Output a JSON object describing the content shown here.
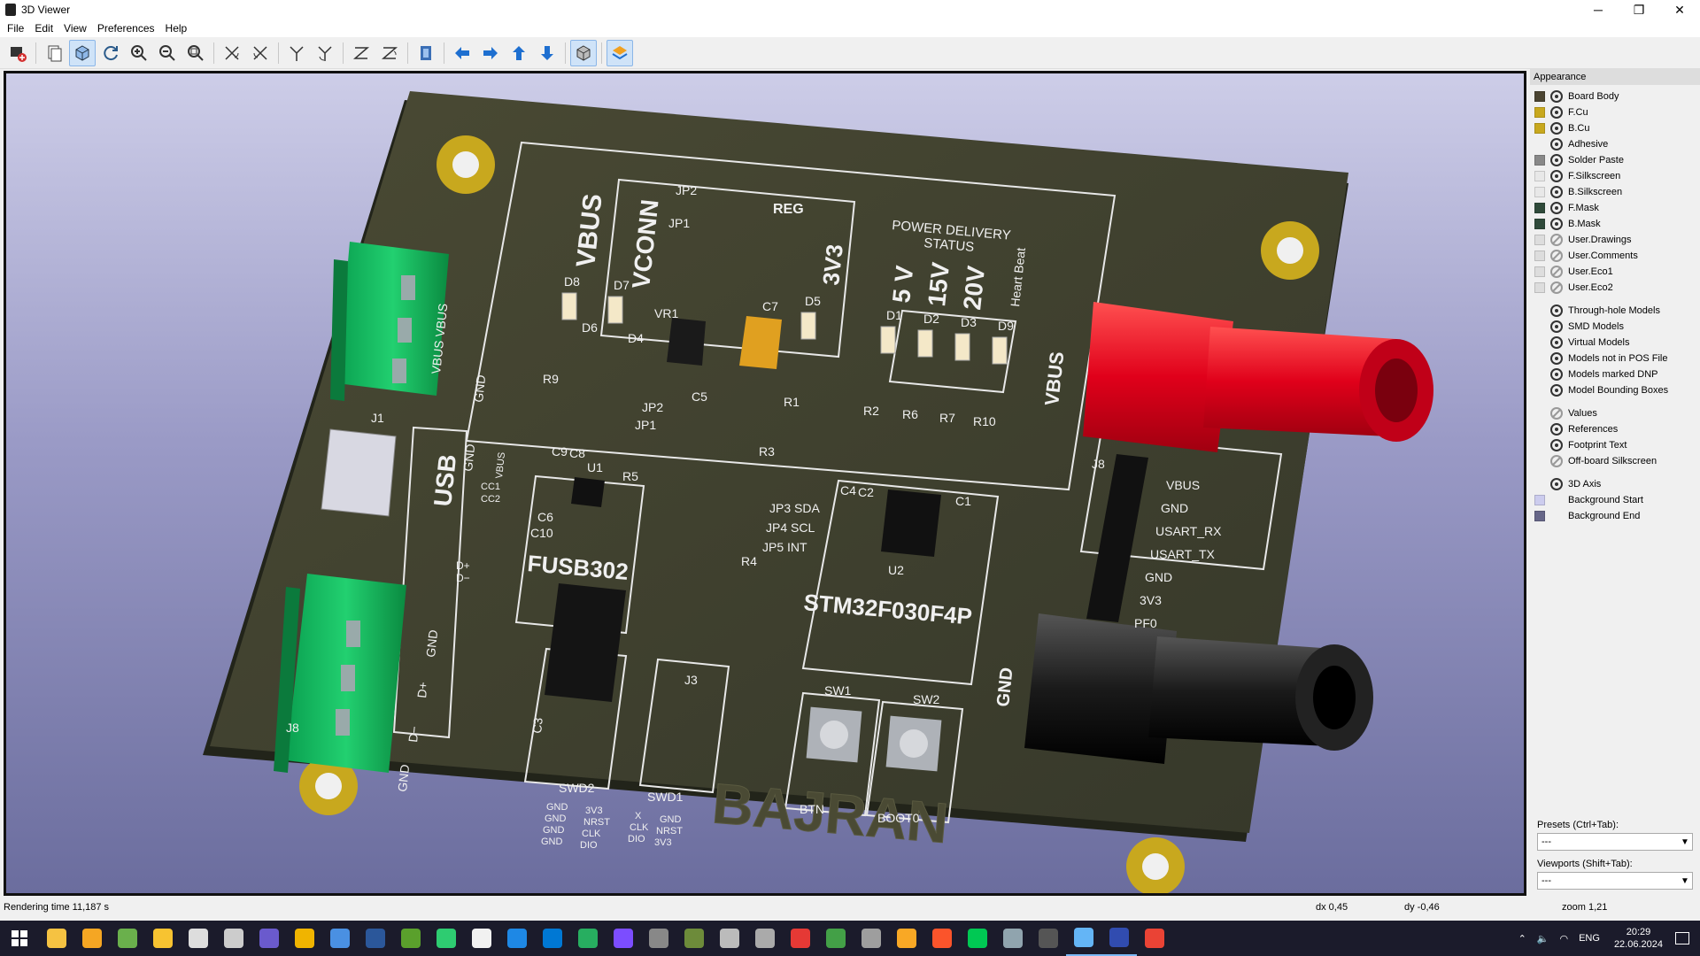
{
  "window": {
    "title": "3D Viewer",
    "controls": [
      "─",
      "❐",
      "✕"
    ]
  },
  "menu": [
    "File",
    "Edit",
    "View",
    "Preferences",
    "Help"
  ],
  "toolbar": {
    "tools": [
      "render-export-icon",
      "copy-icon",
      "raytrace-icon",
      "refresh-icon",
      "zoom-in-icon",
      "zoom-out-icon",
      "zoom-fit-icon",
      "rotate-x-cw-icon",
      "rotate-x-ccw-icon",
      "rotate-y-cw-icon",
      "rotate-y-ccw-icon",
      "rotate-z-cw-icon",
      "rotate-z-ccw-icon",
      "flip-board-icon",
      "pan-left-icon",
      "pan-right-icon",
      "pan-up-icon",
      "pan-down-icon",
      "ortho-icon",
      "layers-icon"
    ]
  },
  "board": {
    "labels": {
      "vbus": "VBUS",
      "vconn": "VCONN",
      "reg": "REG",
      "v3v3": "3V3",
      "pd_status": "POWER DELIVERY",
      "pd_status2": "STATUS",
      "v5": "5 V",
      "v15": "15V",
      "v20": "20V",
      "heartbeat": "Heart Beat",
      "usb": "USB",
      "fusb": "FUSB302",
      "stm": "STM32F030F4P",
      "brand": "BAJRAN",
      "jp2": "JP2",
      "jp1": "JP1",
      "jp2b": "JP2",
      "jp1b": "JP1",
      "d8": "D8",
      "d7": "D7",
      "d6": "D6",
      "d4": "D4",
      "d5": "D5",
      "vr1": "VR1",
      "c7": "C7",
      "c5": "C5",
      "r9": "R9",
      "r1": "R1",
      "d1": "D1",
      "d2": "D2",
      "d3": "D3",
      "d9": "D9",
      "r2": "R2",
      "r6": "R6",
      "r7": "R7",
      "r10": "R10",
      "j1": "J1",
      "j8": "J8",
      "j8b": "J8",
      "c9": "C9",
      "c8": "C8",
      "u1": "U1",
      "r5": "R5",
      "r3": "R3",
      "c6": "C6",
      "c10": "C10",
      "r4": "R4",
      "jp3": "JP3 SDA",
      "jp4": "JP4 SCL",
      "jp5": "JP5 INT",
      "c4": "C4",
      "c2": "C2",
      "c1": "C1",
      "u2": "U2",
      "cc1": "CC1",
      "cc2": "CC2",
      "dp": "D+",
      "dm": "D−",
      "gnd": "GND",
      "vbusvbus": "VBUS VBUS",
      "gnd2": "GND",
      "gnd3": "GND",
      "vbus_small": "VBUS",
      "dplus": "D+",
      "dminus": "D−",
      "gnd4": "GND",
      "gnd5": "GND",
      "j3": "J3",
      "c3": "C3",
      "swd2": "SWD2",
      "swd1": "SWD1",
      "sw1": "SW1",
      "sw2": "SW2",
      "btn": "BTN",
      "boot0": "BOOT0",
      "vbus_right": "VBUS",
      "gnd_right": "GND",
      "pin_vbus": "VBUS",
      "pin_gnd": "GND",
      "pin_rx": "USART_RX",
      "pin_tx": "USART_TX",
      "pin_gnd2": "GND",
      "pin_3v3": "3V3",
      "pin_pf0": "PF0",
      "swd2_l1": "GND",
      "swd2_l2": "GND",
      "swd2_l3": "GND",
      "swd2_l4": "GND",
      "swd2_r1": "3V3",
      "swd2_r2": "NRST",
      "swd2_r3": "CLK",
      "swd2_r4": "DIO",
      "swd1_l1": "X",
      "swd1_l2": "CLK",
      "swd1_l3": "DIO",
      "swd1_r1": "GND",
      "swd1_r2": "NRST",
      "swd1_r3": "3V3"
    }
  },
  "appearance": {
    "title": "Appearance",
    "layers": [
      {
        "name": "Board Body",
        "color": "#4b4532",
        "visible": true
      },
      {
        "name": "F.Cu",
        "color": "#c8a81e",
        "visible": true
      },
      {
        "name": "B.Cu",
        "color": "#c8a81e",
        "visible": true
      },
      {
        "name": "Adhesive",
        "color": "",
        "visible": true
      },
      {
        "name": "Solder Paste",
        "color": "#888888",
        "visible": true
      },
      {
        "name": "F.Silkscreen",
        "color": "#e8e8e8",
        "visible": true
      },
      {
        "name": "B.Silkscreen",
        "color": "#e8e8e8",
        "visible": true
      },
      {
        "name": "F.Mask",
        "color": "#2f4a3a",
        "visible": true
      },
      {
        "name": "B.Mask",
        "color": "#2f4a3a",
        "visible": true
      },
      {
        "name": "User.Drawings",
        "color": "#dddddd",
        "visible": false
      },
      {
        "name": "User.Comments",
        "color": "#dddddd",
        "visible": false
      },
      {
        "name": "User.Eco1",
        "color": "#dddddd",
        "visible": false
      },
      {
        "name": "User.Eco2",
        "color": "#dddddd",
        "visible": false
      }
    ],
    "models": [
      {
        "name": "Through-hole Models",
        "visible": true
      },
      {
        "name": "SMD Models",
        "visible": true
      },
      {
        "name": "Virtual Models",
        "visible": true
      },
      {
        "name": "Models not in POS File",
        "visible": true
      },
      {
        "name": "Models marked DNP",
        "visible": true
      },
      {
        "name": "Model Bounding Boxes",
        "visible": true
      }
    ],
    "text": [
      {
        "name": "Values",
        "visible": false
      },
      {
        "name": "References",
        "visible": true
      },
      {
        "name": "Footprint Text",
        "visible": true
      },
      {
        "name": "Off-board Silkscreen",
        "visible": false
      }
    ],
    "misc": [
      {
        "name": "3D Axis",
        "color": "",
        "visible": true
      },
      {
        "name": "Background Start",
        "color": "#ccccee",
        "visible": null
      },
      {
        "name": "Background End",
        "color": "#666688",
        "visible": null
      }
    ],
    "presets_label": "Presets (Ctrl+Tab):",
    "presets_value": "---",
    "viewports_label": "Viewports (Shift+Tab):",
    "viewports_value": "---"
  },
  "status": {
    "render_time": "Rendering time 11,187 s",
    "dx": "dx 0,45",
    "dy": "dy -0,46",
    "zoom": "zoom 1,21"
  },
  "taskbar": {
    "apps": [
      {
        "name": "explorer",
        "color": "#f5c242"
      },
      {
        "name": "app2",
        "color": "#f5a623"
      },
      {
        "name": "chrome-green",
        "color": "#6ab04c"
      },
      {
        "name": "notes",
        "color": "#f7c331"
      },
      {
        "name": "calc",
        "color": "#dddddd"
      },
      {
        "name": "calendar",
        "color": "#cccccc"
      },
      {
        "name": "app7",
        "color": "#6a5acd"
      },
      {
        "name": "app8",
        "color": "#f0b400"
      },
      {
        "name": "app9",
        "color": "#4a90e2"
      },
      {
        "name": "word",
        "color": "#2b579a"
      },
      {
        "name": "excel",
        "color": "#5aa02c"
      },
      {
        "name": "app12",
        "color": "#2ecc71"
      },
      {
        "name": "app13",
        "color": "#f1f1f1"
      },
      {
        "name": "processing",
        "color": "#1e88e5"
      },
      {
        "name": "vscode",
        "color": "#0078d4"
      },
      {
        "name": "app16",
        "color": "#27ae60"
      },
      {
        "name": "app17",
        "color": "#7c4dff"
      },
      {
        "name": "app18",
        "color": "#888888"
      },
      {
        "name": "app19",
        "color": "#6d8b3a"
      },
      {
        "name": "app20",
        "color": "#bbbbbb"
      },
      {
        "name": "app21",
        "color": "#aaaaaa"
      },
      {
        "name": "acrobat",
        "color": "#e53935"
      },
      {
        "name": "sync",
        "color": "#43a047"
      },
      {
        "name": "github",
        "color": "#9e9e9e"
      },
      {
        "name": "app25",
        "color": "#f9a825"
      },
      {
        "name": "brave",
        "color": "#fb542b"
      },
      {
        "name": "app27",
        "color": "#00c853"
      },
      {
        "name": "app28",
        "color": "#90a4ae"
      },
      {
        "name": "terminal",
        "color": "#555555"
      },
      {
        "name": "app30",
        "color": "#64b5f6"
      },
      {
        "name": "kicad",
        "color": "#314cb0"
      },
      {
        "name": "chrome",
        "color": "#ea4335"
      }
    ],
    "lang": "ENG",
    "time": "20:29",
    "date": "22.06.2024"
  }
}
